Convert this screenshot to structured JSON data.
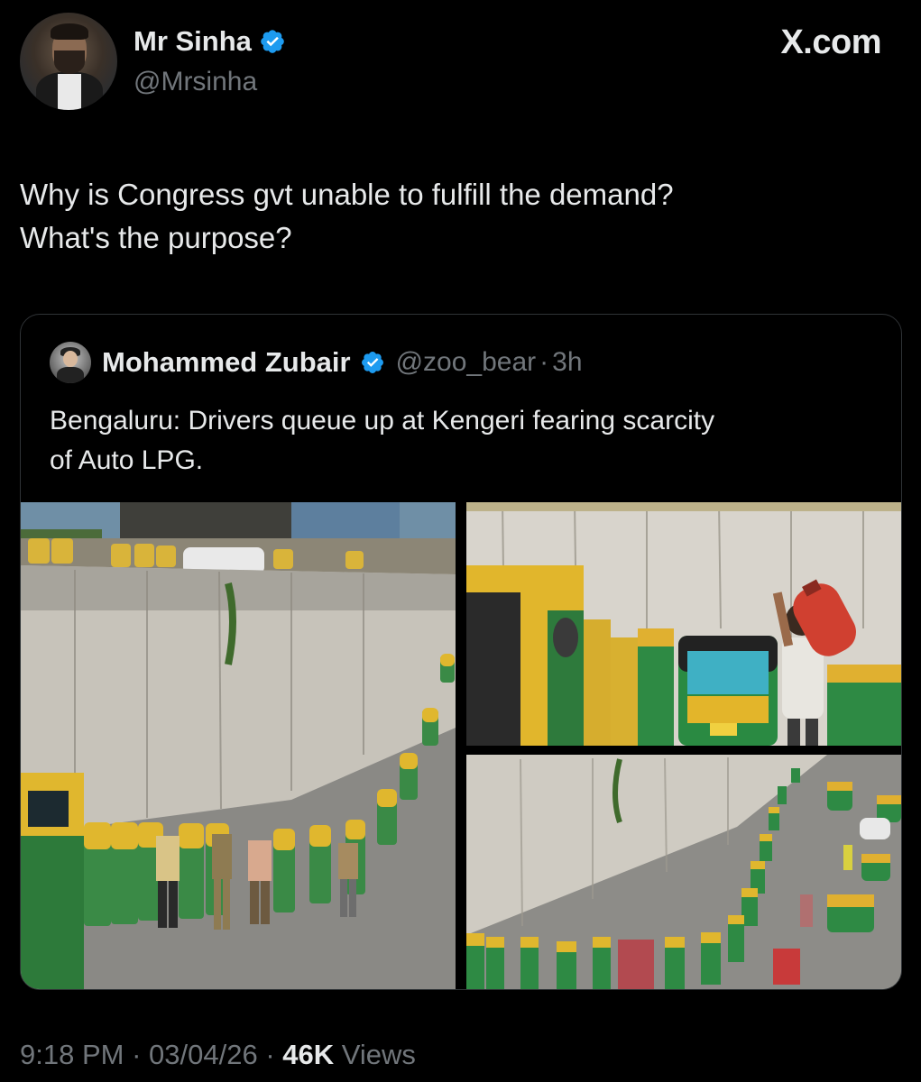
{
  "brand": {
    "watermark": "X.com"
  },
  "author": {
    "display_name": "Mr Sinha",
    "handle": "@Mrsinha"
  },
  "tweet": {
    "text_line1": "Why is Congress gvt unable to fulfill the demand?",
    "text_line2": "What's the purpose?"
  },
  "quoted": {
    "display_name": "Mohammed Zubair",
    "handle": "@zoo_bear",
    "separator": "·",
    "age": "3h",
    "text_line1": "Bengaluru: Drivers queue up at Kengeri fearing scarcity",
    "text_line2": "of Auto LPG."
  },
  "meta": {
    "time": "9:18 PM",
    "sep1": "·",
    "date": "03/04/26",
    "sep2": "·",
    "views_count": "46K",
    "views_label": "Views"
  },
  "colors": {
    "background": "#000000",
    "text": "#e7e9ea",
    "secondary": "#71767b",
    "verified": "#1d9bf0",
    "border": "#2f3336"
  },
  "icons": {
    "verified": "verified-badge-icon"
  }
}
